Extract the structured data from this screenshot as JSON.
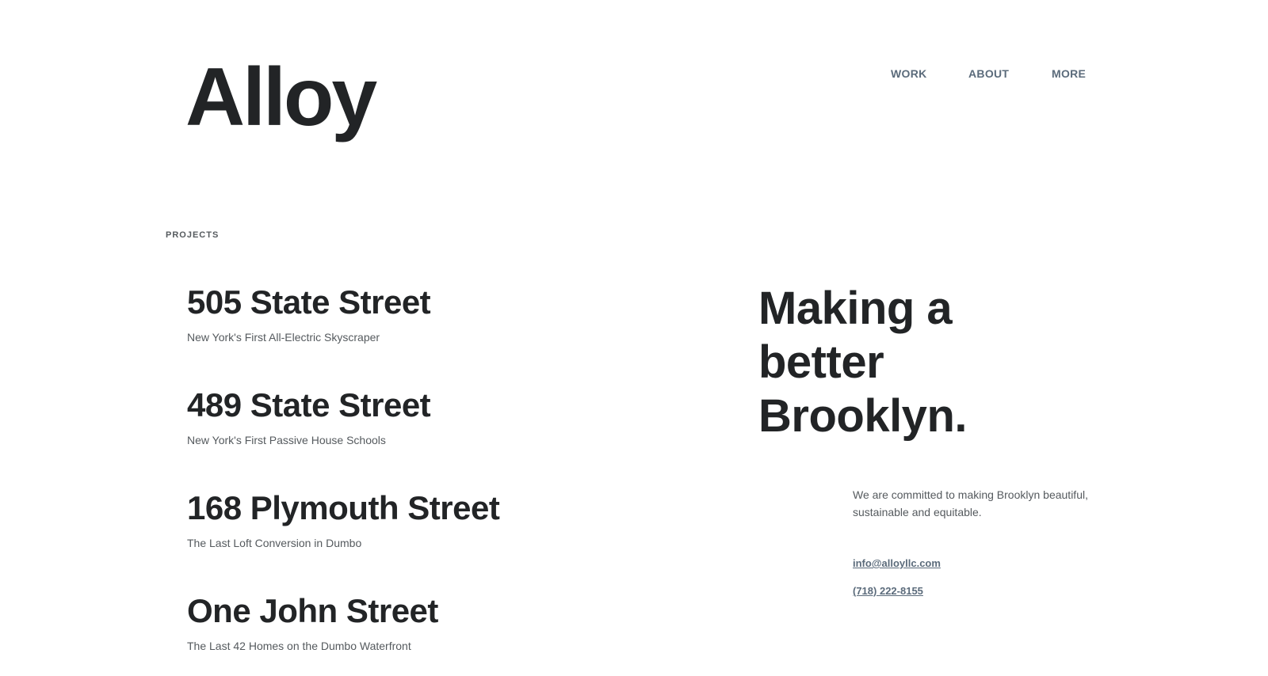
{
  "header": {
    "logo": "Alloy",
    "nav": [
      {
        "label": "WORK"
      },
      {
        "label": "ABOUT"
      },
      {
        "label": "MORE"
      }
    ]
  },
  "projects": {
    "label": "PROJECTS",
    "items": [
      {
        "title": "505 State Street",
        "subtitle": "New York's First All-Electric Skyscraper"
      },
      {
        "title": "489 State Street",
        "subtitle": "New York's First Passive House Schools"
      },
      {
        "title": "168 Plymouth Street",
        "subtitle": "The Last Loft Conversion in Dumbo"
      },
      {
        "title": "One John Street",
        "subtitle": "The Last 42 Homes on the Dumbo Waterfront"
      }
    ]
  },
  "aside": {
    "tagline": "Making a better Brooklyn.",
    "description": "We are committed to making Brooklyn beautiful, sustainable and equitable.",
    "email": "info@alloyllc.com",
    "phone": "(718) 222-8155"
  },
  "colors": {
    "text": "#222426",
    "muted": "#555a5e",
    "link": "#5b6b7b",
    "background": "#ffffff"
  }
}
